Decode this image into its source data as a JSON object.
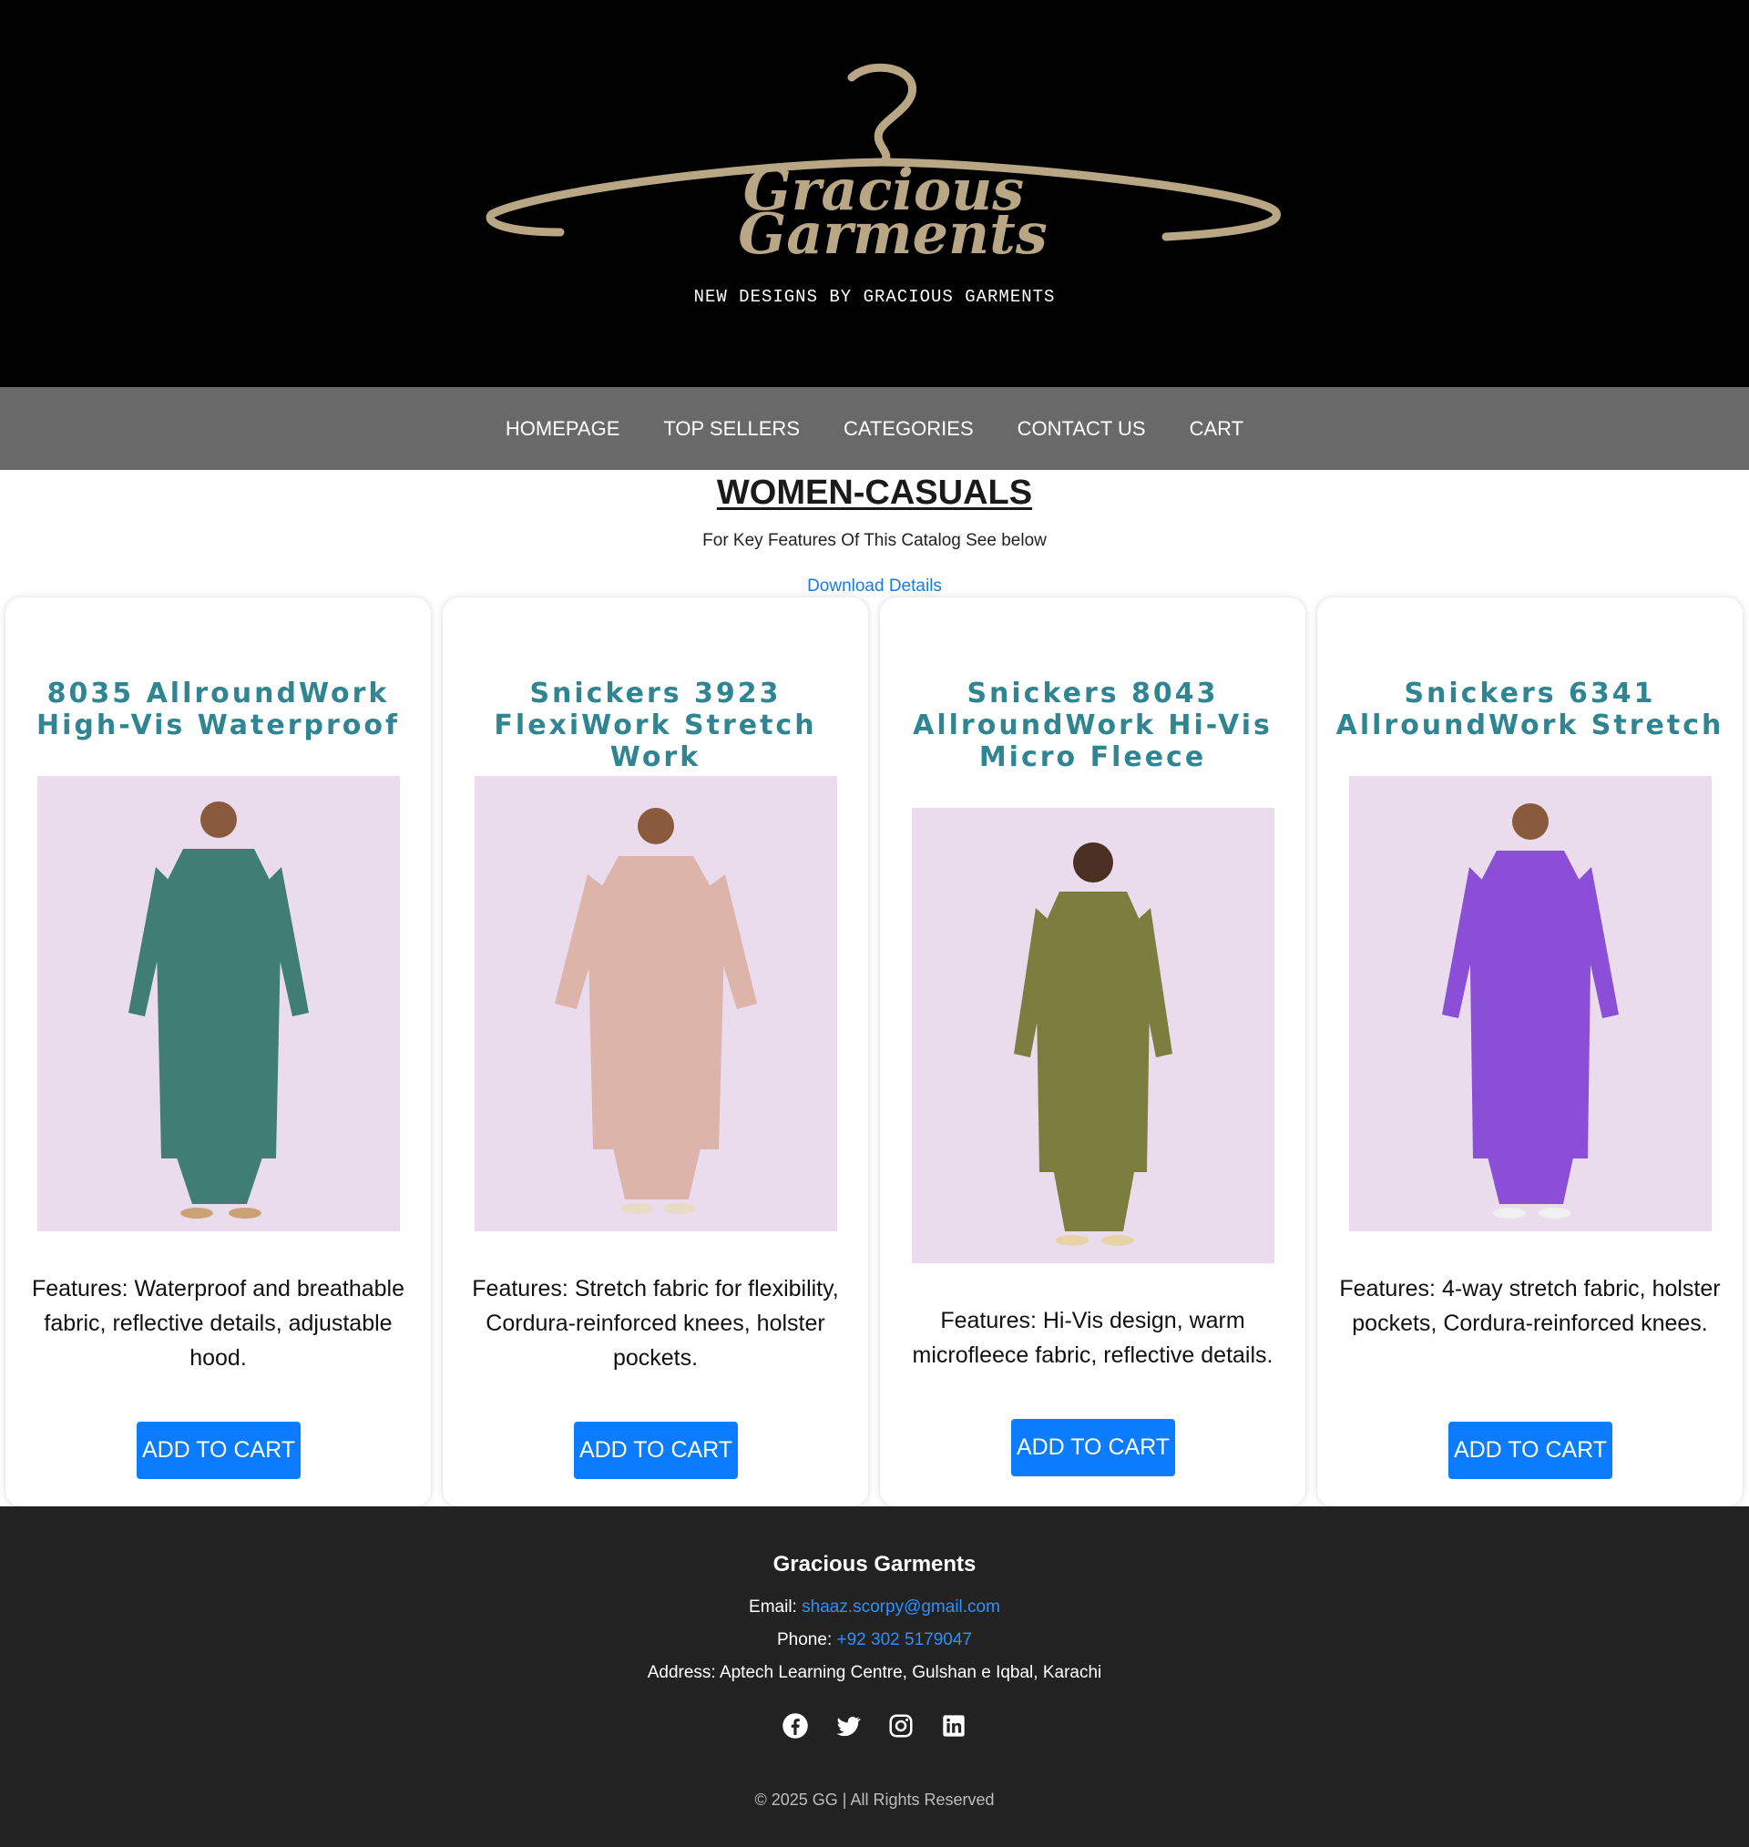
{
  "header": {
    "logo_text_line1": "Gracious",
    "logo_text_line2": "Garments",
    "tagline": "NEW DESIGNS BY GRACIOUS GARMENTS"
  },
  "nav": {
    "items": [
      {
        "label": "HOMEPAGE"
      },
      {
        "label": "TOP SELLERS"
      },
      {
        "label": "CATEGORIES"
      },
      {
        "label": "CONTACT US"
      },
      {
        "label": "CART"
      }
    ]
  },
  "section": {
    "title": "WOMEN-CASUALS",
    "subtitle": "For Key Features Of This Catalog See below",
    "download_link": "Download Details"
  },
  "products": [
    {
      "title": "8035 AllroundWork High-Vis Waterproof",
      "features": "Features: Waterproof and breathable fabric, reflective details, adjustable hood.",
      "button": "ADD TO CART",
      "garment_color": "#3f7d75"
    },
    {
      "title": "Snickers 3923 FlexiWork Stretch Work",
      "features": "Features: Stretch fabric for flexibility, Cordura-reinforced knees, holster pockets.",
      "button": "ADD TO CART",
      "garment_color": "#dcb4aa"
    },
    {
      "title": "Snickers 8043 AllroundWork Hi-Vis Micro Fleece",
      "features": "Features: Hi-Vis design, warm microfleece fabric, reflective details.",
      "button": "ADD TO CART",
      "garment_color": "#7c7e3f"
    },
    {
      "title": "Snickers 6341 AllroundWork Stretch",
      "features": "Features: 4-way stretch fabric, holster pockets, Cordura-reinforced knees.",
      "button": "ADD TO CART",
      "garment_color": "#8a4fd6"
    }
  ],
  "footer": {
    "brand": "Gracious Garments",
    "email_label": "Email:",
    "email": "shaaz.scorpy@gmail.com",
    "phone_label": "Phone:",
    "phone": "+92 302 5179047",
    "address": "Address: Aptech Learning Centre, Gulshan e Iqbal, Karachi",
    "socials": [
      "facebook-icon",
      "twitter-icon",
      "instagram-icon",
      "linkedin-icon"
    ],
    "copyright": "© 2025 GG | All Rights Reserved"
  },
  "colors": {
    "accent": "#0b7bff",
    "title_teal": "#2f8592",
    "nav_bg": "#696969",
    "footer_bg": "#222222",
    "logo_gold": "#b9a684"
  }
}
